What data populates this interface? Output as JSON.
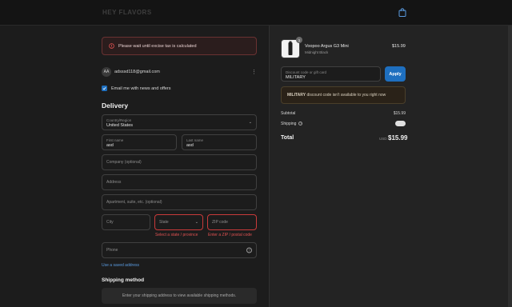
{
  "header": {
    "logo_text": "HEY FLAVORS"
  },
  "alert": {
    "text": "Please wait until excise tax is calculated"
  },
  "account": {
    "initials": "AA",
    "email": "adsssd118@gmail.com",
    "menu": "⋮"
  },
  "newsletter": {
    "label": "Email me with news and offers",
    "checked": true
  },
  "delivery": {
    "heading": "Delivery",
    "country_label": "Country/Region",
    "country_value": "United States",
    "first_name_label": "First name",
    "first_name_value": "asd",
    "last_name_label": "Last name",
    "last_name_value": "asd",
    "company_placeholder": "Company (optional)",
    "address_placeholder": "Address",
    "apartment_placeholder": "Apartment, suite, etc. (optional)",
    "city_placeholder": "City",
    "state_placeholder": "State",
    "zip_placeholder": "ZIP code",
    "state_error": "Select a state / province",
    "zip_error": "Enter a ZIP / postal code",
    "phone_placeholder": "Phone",
    "saved_address_link": "Use a saved address"
  },
  "shipping": {
    "heading": "Shipping method",
    "placeholder": "Enter your shipping address to view available shipping methods."
  },
  "summary": {
    "product": {
      "name": "Voopoo Argus G3 Mini",
      "variant": "Midnight Black",
      "price": "$15.99",
      "quantity": "1"
    },
    "discount_label": "Discount code or gift card",
    "discount_value": "MILITARY",
    "apply_label": "Apply",
    "discount_message_code": "MILITARY",
    "discount_message": " discount code isn't available to you right now",
    "subtotal_label": "Subtotal",
    "subtotal_value": "$15.99",
    "shipping_label": "Shipping",
    "total_label": "Total",
    "total_currency": "USD",
    "total_value": "$15.99"
  },
  "colors": {
    "accent": "#1e6fbf",
    "error": "#e05252",
    "background": "#1c1c1c",
    "summary_bg": "#232323"
  }
}
